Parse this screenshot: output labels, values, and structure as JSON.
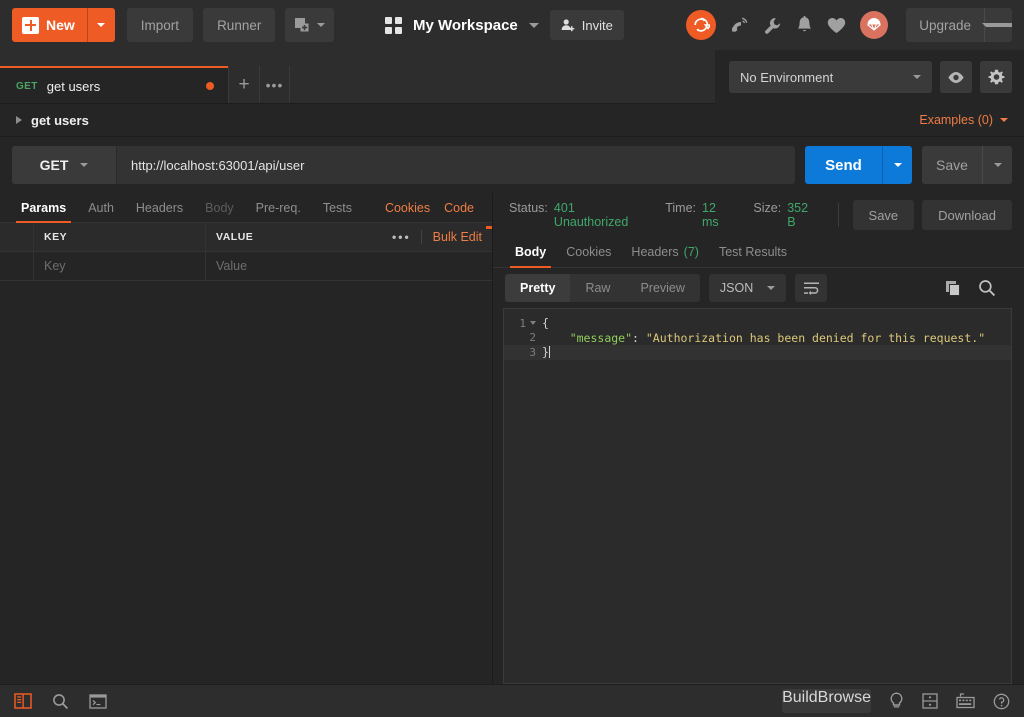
{
  "toolbar": {
    "new_label": "New",
    "new_icon": "plus-square-icon",
    "import_label": "Import",
    "runner_label": "Runner",
    "new_window_icon": "new-window-icon",
    "workspace_icon": "grid-icon",
    "workspace_name": "My Workspace",
    "invite_label": "Invite",
    "invite_icon": "person-add-icon",
    "sync_icon": "sync-icon",
    "antenna_icon": "satellite-antenna-icon",
    "wrench_icon": "wrench-icon",
    "bell_icon": "bell-icon",
    "heart_icon": "heart-icon",
    "avatar_icon": "parachute-avatar-icon",
    "upgrade_label": "Upgrade"
  },
  "tabs": {
    "items": [
      {
        "method": "GET",
        "name": "get users",
        "unsaved": true
      }
    ],
    "add_icon": "plus-icon",
    "more_icon": "ellipsis-icon"
  },
  "environment": {
    "selected": "No Environment",
    "eye_icon": "eye-icon",
    "gear_icon": "gear-icon"
  },
  "breadcrumb": {
    "label": "get users",
    "examples_label": "Examples (0)"
  },
  "request": {
    "method": "GET",
    "url": "http://localhost:63001/api/user",
    "send_label": "Send",
    "save_label": "Save",
    "tabs": [
      {
        "label": "Params",
        "state": "active"
      },
      {
        "label": "Auth",
        "state": "normal"
      },
      {
        "label": "Headers",
        "state": "normal"
      },
      {
        "label": "Body",
        "state": "disabled"
      },
      {
        "label": "Pre-req.",
        "state": "normal"
      },
      {
        "label": "Tests",
        "state": "normal"
      }
    ],
    "cookies_label": "Cookies",
    "code_label": "Code",
    "params": {
      "columns": [
        "KEY",
        "VALUE"
      ],
      "more_icon": "ellipsis-icon",
      "bulk_edit_label": "Bulk Edit",
      "rows": [
        {
          "key_placeholder": "Key",
          "value_placeholder": "Value"
        }
      ]
    }
  },
  "response": {
    "status_label": "Status:",
    "status_value": "401 Unauthorized",
    "time_label": "Time:",
    "time_value": "12 ms",
    "size_label": "Size:",
    "size_value": "352 B",
    "save_label": "Save",
    "download_label": "Download",
    "tabs": [
      {
        "label": "Body",
        "count": "",
        "state": "active"
      },
      {
        "label": "Cookies",
        "count": "",
        "state": "normal"
      },
      {
        "label": "Headers",
        "count": "(7)",
        "state": "normal"
      },
      {
        "label": "Test Results",
        "count": "",
        "state": "normal"
      }
    ],
    "views": [
      {
        "label": "Pretty",
        "state": "active"
      },
      {
        "label": "Raw",
        "state": "normal"
      },
      {
        "label": "Preview",
        "state": "normal"
      }
    ],
    "format": "JSON",
    "wrap_icon": "word-wrap-icon",
    "copy_icon": "copy-icon",
    "search_icon": "search-icon",
    "body_lines": [
      {
        "num": "1",
        "fold": true,
        "highlighted": false,
        "punct_open": "{"
      },
      {
        "num": "2",
        "fold": false,
        "highlighted": false,
        "indent": "    ",
        "key": "\"message\"",
        "sep": ": ",
        "value": "\"Authorization has been denied for this request.\""
      },
      {
        "num": "3",
        "fold": false,
        "highlighted": true,
        "punct_close": "}"
      }
    ]
  },
  "statusbar": {
    "sidebar_toggle_icon": "sidebar-toggle-icon",
    "find_icon": "search-icon",
    "console_icon": "console-icon",
    "build_label": "Build",
    "browse_label": "Browse",
    "bulb_icon": "lightbulb-icon",
    "layout_icon": "two-pane-layout-icon",
    "keyboard_icon": "keyboard-icon",
    "help_icon": "help-circle-icon"
  },
  "colors": {
    "accent": "#ef5b25",
    "send": "#0d7ada",
    "success": "#3fa76b",
    "bg": "#252525",
    "panel": "#2d2d2d"
  }
}
